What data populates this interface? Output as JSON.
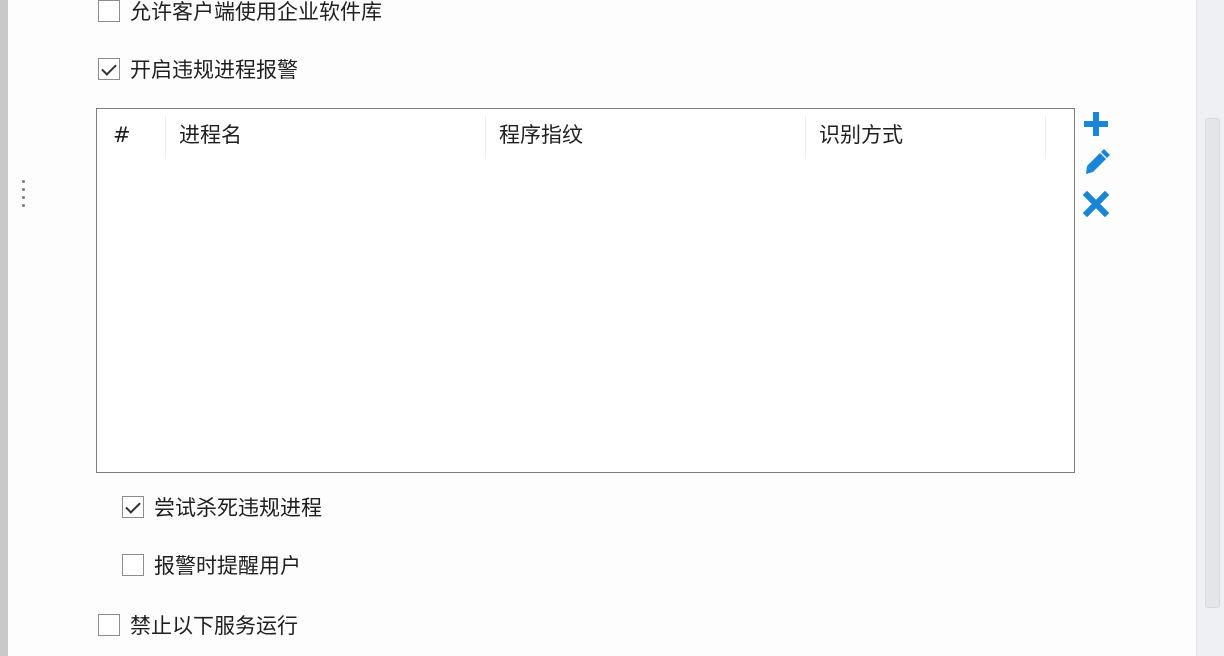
{
  "options": {
    "allow_enterprise_software_library": {
      "label": "允许客户端使用企业软件库",
      "checked": false
    },
    "enable_violation_process_alarm": {
      "label": "开启违规进程报警",
      "checked": true
    },
    "try_kill_violation_process": {
      "label": "尝试杀死违规进程",
      "checked": true
    },
    "notify_user_on_alarm": {
      "label": "报警时提醒用户",
      "checked": false
    },
    "forbid_services": {
      "label": "禁止以下服务运行",
      "checked": false
    }
  },
  "process_table": {
    "columns": [
      "#",
      "进程名",
      "程序指纹",
      "识别方式"
    ],
    "rows": []
  },
  "actions": {
    "add_icon": "plus-icon",
    "edit_icon": "pencil-icon",
    "delete_icon": "x-icon",
    "accent_color": "#1a84d6"
  }
}
